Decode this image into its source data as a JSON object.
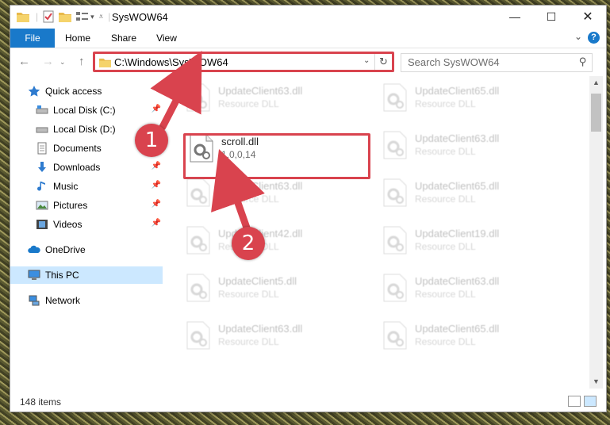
{
  "window": {
    "title": "SysWOW64"
  },
  "ribbon": {
    "file": "File",
    "home": "Home",
    "share": "Share",
    "view": "View",
    "help": "?"
  },
  "address": {
    "path": "C:\\Windows\\SysWOW64"
  },
  "search": {
    "placeholder": "Search SysWOW64"
  },
  "sidebar": {
    "items": [
      {
        "label": "Quick access"
      },
      {
        "label": "Local Disk (C:)"
      },
      {
        "label": "Local Disk (D:)"
      },
      {
        "label": "Documents"
      },
      {
        "label": "Downloads"
      },
      {
        "label": "Music"
      },
      {
        "label": "Pictures"
      },
      {
        "label": "Videos"
      },
      {
        "label": "OneDrive"
      },
      {
        "label": "This PC"
      },
      {
        "label": "Network"
      }
    ]
  },
  "files": {
    "left": [
      {
        "name": "UpdateClient63.dll",
        "sub": "Resource DLL"
      },
      {
        "name": "scroll.dll",
        "sub": "1,0,0,14"
      },
      {
        "name": "UpdateClient63.dll",
        "sub": "Resource DLL"
      },
      {
        "name": "UpdateClient42.dll",
        "sub": "Resource DLL"
      },
      {
        "name": "UpdateClient5.dll",
        "sub": "Resource DLL"
      },
      {
        "name": "UpdateClient63.dll",
        "sub": "Resource DLL"
      }
    ],
    "right": [
      {
        "name": "UpdateClient65.dll",
        "sub": "Resource DLL"
      },
      {
        "name": "UpdateClient63.dll",
        "sub": "Resource DLL"
      },
      {
        "name": "UpdateClient65.dll",
        "sub": "Resource DLL"
      },
      {
        "name": "UpdateClient19.dll",
        "sub": "Resource DLL"
      },
      {
        "name": "UpdateClient63.dll",
        "sub": "Resource DLL"
      },
      {
        "name": "UpdateClient65.dll",
        "sub": "Resource DLL"
      }
    ]
  },
  "status": {
    "count": "148 items"
  },
  "annotations": {
    "step1": "1",
    "step2": "2"
  },
  "colors": {
    "accent": "#1979ca",
    "highlight": "#d9434e",
    "selected": "#cce8ff"
  }
}
